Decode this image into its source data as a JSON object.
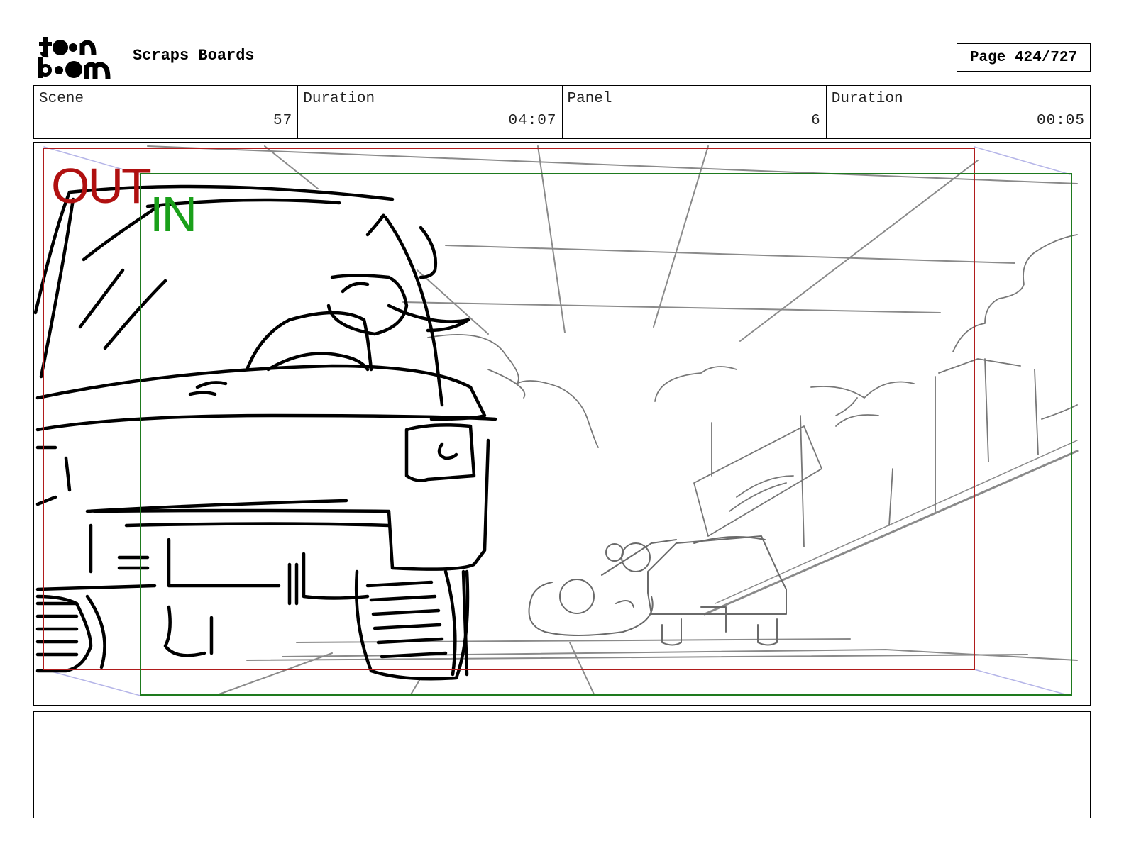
{
  "header": {
    "logo_text": "toon boom",
    "project_title": "Scraps Boards",
    "page_label": "Page 424/727"
  },
  "info": [
    {
      "label": "Scene",
      "value": "57"
    },
    {
      "label": "Duration",
      "value": "04:07"
    },
    {
      "label": "Panel",
      "value": "6"
    },
    {
      "label": "Duration",
      "value": "00:05"
    }
  ],
  "panel": {
    "camera_out_label": "OUT",
    "camera_in_label": "IN",
    "camera_out_color": "#b01010",
    "camera_in_color": "#1aa01a",
    "frame_description_visible": false
  },
  "notes": {
    "text": ""
  }
}
